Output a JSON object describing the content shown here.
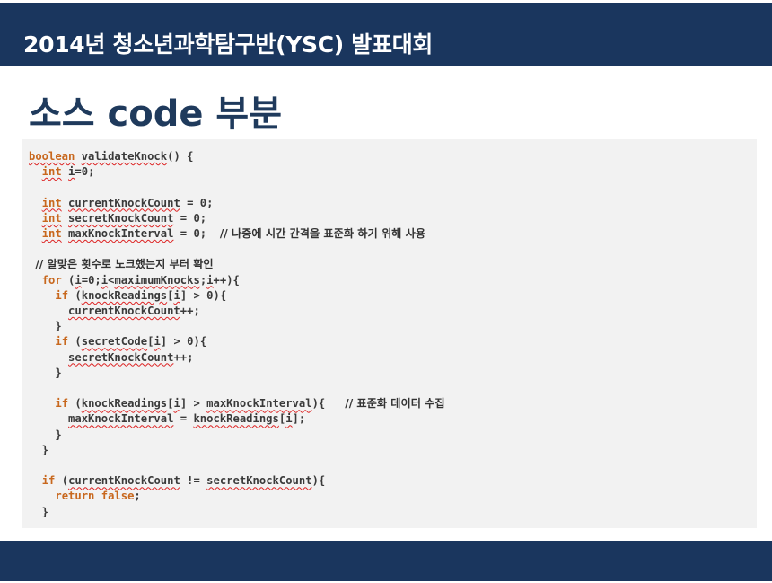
{
  "header": {
    "title": "2014년 청소년과학탐구반(YSC) 발표대회"
  },
  "slide": {
    "title": "소스 code 부분"
  },
  "code": {
    "lines": [
      "boolean validateKnock() {",
      "  int i=0;",
      "",
      "  int currentKnockCount = 0;",
      "  int secretKnockCount = 0;",
      "  int maxKnockInterval = 0;  // 나중에 시간 간격을 표준화 하기 위해 사용",
      "",
      " // 알맞은 횟수로 노크했는지 부터 확인",
      "  for (i=0;i<maximumKnocks;i++){",
      "    if (knockReadings[i] > 0){",
      "      currentKnockCount++;",
      "    }",
      "    if (secretCode[i] > 0){",
      "      secretKnockCount++;",
      "    }",
      "",
      "    if (knockReadings[i] > maxKnockInterval){   // 표준화 데이터 수집",
      "      maxKnockInterval = knockReadings[i];",
      "    }",
      "  }",
      "",
      "  if (currentKnockCount != secretKnockCount){",
      "    return false;",
      "  }"
    ]
  },
  "colors": {
    "header_bg": "#1a365e",
    "title_color": "#1f3a5c",
    "keyword": "#c8681e",
    "code_bg": "#f2f2f2"
  }
}
